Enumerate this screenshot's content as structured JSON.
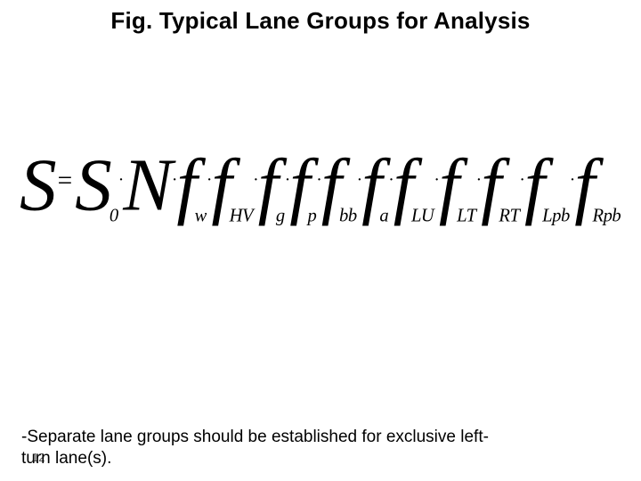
{
  "title": "Fig. Typical Lane Groups for Analysis",
  "equation": {
    "lhs": "S",
    "eq": "=",
    "rhs_base": "S",
    "rhs_base_sub": "0",
    "dot": "·",
    "N": "N",
    "factors": [
      {
        "letter": "f",
        "sub": "w"
      },
      {
        "letter": "f",
        "sub": "HV"
      },
      {
        "letter": "f",
        "sub": "g"
      },
      {
        "letter": "f",
        "sub": "p"
      },
      {
        "letter": "f",
        "sub": "bb"
      },
      {
        "letter": "f",
        "sub": "a"
      },
      {
        "letter": "f",
        "sub": "LU"
      },
      {
        "letter": "f",
        "sub": "LT"
      },
      {
        "letter": "f",
        "sub": "RT"
      },
      {
        "letter": "f",
        "sub": "Lpb"
      },
      {
        "letter": "f",
        "sub": "Rpb"
      }
    ]
  },
  "caption_line1": " -Separate lane groups should be established for exclusive left-",
  "caption_line2": "turn lane(s).",
  "page_number": "12"
}
